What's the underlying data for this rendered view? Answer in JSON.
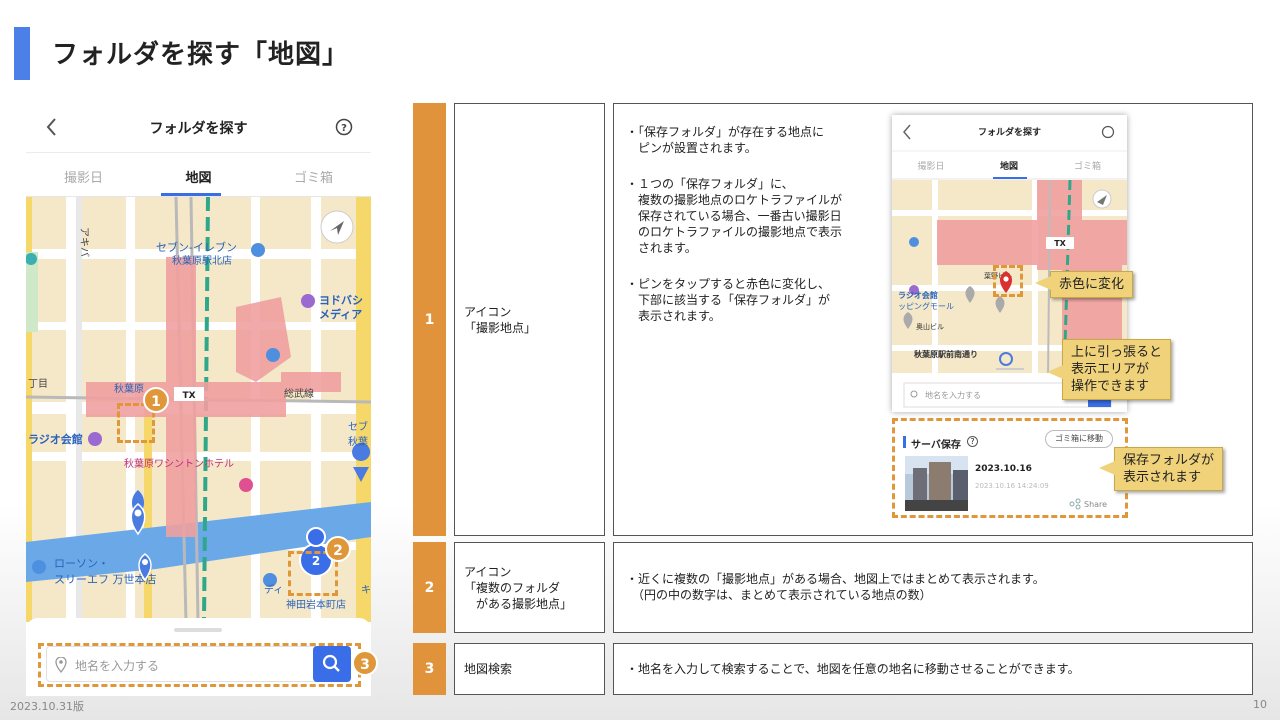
{
  "slide": {
    "title": "フォルダを探す「地図」",
    "footer_date": "2023.10.31版",
    "page_number": "10"
  },
  "phone": {
    "header_title": "フォルダを探す",
    "tabs": [
      "撮影日",
      "地図",
      "ゴミ箱"
    ],
    "active_tab": "地図",
    "map_labels": {
      "akiba": "アキバ",
      "seven": "セブン-イレブン",
      "seven_sub": "秋葉原駅北店",
      "yodobashi": "ヨドバシ",
      "yodobashi_sub": "メディア",
      "sobu": "総武線",
      "akiba_station": "秋葉原",
      "radio": "ラジオ会館",
      "washington": "秋葉原ワシントンホテル",
      "lawson": "ローソン・",
      "lawson_sub": "スリーエフ 万世本店",
      "kanda": "神田岩本町店",
      "chome": "丁目",
      "sef": "セブ",
      "aki2": "秋葉",
      "di": "ディ",
      "ki": "キ",
      "jr": "JR",
      "tx": "TX"
    },
    "cluster_count": "2",
    "search_placeholder": "地名を入力する",
    "badges": [
      "1",
      "2",
      "3"
    ]
  },
  "rows": [
    {
      "num": "1",
      "name": "アイコン\n「撮影地点」",
      "bullets": [
        "・「保存フォルダ」が存在する地点に\n　ピンが設置されます。",
        "・１つの「保存フォルダ」に、\n　複数の撮影地点のロケトラファイルが\n　保存されている場合、一番古い撮影日\n　のロケトラファイルの撮影地点で表示\n　されます。",
        "・ピンをタップすると赤色に変化し、\n　下部に該当する「保存フォルダ」が\n　表示されます。"
      ]
    },
    {
      "num": "2",
      "name": "アイコン\n「複数のフォルダ\n　がある撮影地点」",
      "bullets": [
        "・近くに複数の「撮影地点」がある場合、地図上ではまとめて表示されます。\n　（円の中の数字は、まとめて表示されている地点の数）"
      ]
    },
    {
      "num": "3",
      "name": "地図検索",
      "bullets": [
        "・地名を入力して検索することで、地図を任意の地名に移動させることができます。"
      ]
    }
  ],
  "mini": {
    "title": "フォルダを探す",
    "tabs": [
      "撮影日",
      "地図",
      "ゴミ箱"
    ],
    "search_placeholder": "地名を入力する",
    "map_labels": {
      "radio": "ラジオ会館",
      "radio_sub": "ッピングモール",
      "oku": "奥山ビル",
      "street": "秋葉原駅前南通り",
      "kiba": "葉野ビル",
      "jr": "JR",
      "tx": "TX"
    },
    "card": {
      "section_title": "サーバ保存",
      "trash_button": "ゴミ箱に移動",
      "date": "2023.10.16",
      "datetime": "2023.10.16 14:24:09",
      "share": "Share"
    }
  },
  "callouts": {
    "red": "赤色に変化",
    "pull": "上に引っ張ると\n表示エリアが\n操作できます",
    "folder": "保存フォルダが\n表示されます"
  },
  "colors": {
    "accent_blue": "#4c7fe8",
    "orange": "#e1933c",
    "callout_yellow": "#f0d27a",
    "pin_blue": "#4a7be0",
    "pin_red": "#d93030"
  }
}
